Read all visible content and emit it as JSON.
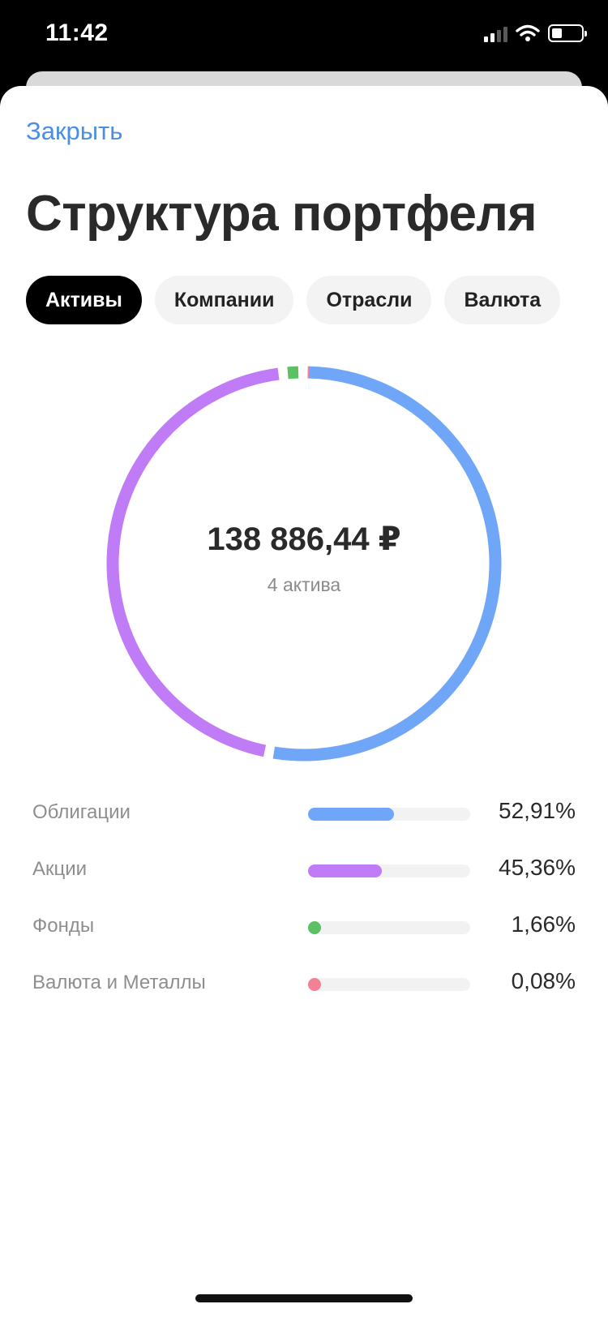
{
  "status_bar": {
    "time": "11:42",
    "battery_level": 0.35
  },
  "header": {
    "close_label": "Закрыть",
    "title": "Структура портфеля"
  },
  "tabs": [
    {
      "label": "Активы",
      "active": true
    },
    {
      "label": "Компании",
      "active": false
    },
    {
      "label": "Отрасли",
      "active": false
    },
    {
      "label": "Валюта",
      "active": false
    }
  ],
  "summary": {
    "total": "138 886,44 ₽",
    "asset_count_label": "4 актива"
  },
  "colors": {
    "bonds": "#6fa6f7",
    "stocks": "#c07cf7",
    "funds": "#5cc065",
    "currency_metals": "#f28195",
    "link": "#4a8ee6"
  },
  "chart_data": {
    "type": "pie",
    "style": "donut",
    "series": [
      {
        "name": "Облигации",
        "value": 52.91,
        "value_label": "52,91%",
        "color": "#6fa6f7"
      },
      {
        "name": "Акции",
        "value": 45.36,
        "value_label": "45,36%",
        "color": "#c07cf7"
      },
      {
        "name": "Фонды",
        "value": 1.66,
        "value_label": "1,66%",
        "color": "#5cc065"
      },
      {
        "name": "Валюта и Металлы",
        "value": 0.08,
        "value_label": "0,08%",
        "color": "#f28195"
      }
    ]
  }
}
